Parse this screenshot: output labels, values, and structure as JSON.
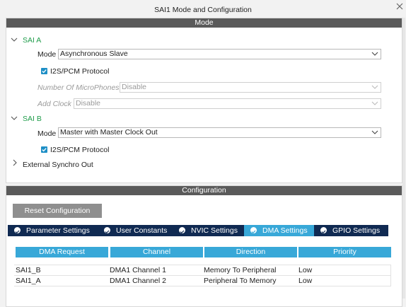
{
  "window": {
    "title": "SAI1 Mode and Configuration"
  },
  "mode_panel": {
    "header": "Mode",
    "sai_a": {
      "label": "SAI A",
      "mode_label": "Mode",
      "mode_value": "Asynchronous Slave",
      "i2s_label": "I2S/PCM Protocol",
      "i2s_checked": true,
      "mics_label": "Number Of MicroPhones",
      "mics_value": "Disable",
      "clock_label": "Add Clock",
      "clock_value": "Disable"
    },
    "sai_b": {
      "label": "SAI B",
      "mode_label": "Mode",
      "mode_value": "Master with Master Clock Out",
      "i2s_label": "I2S/PCM Protocol",
      "i2s_checked": true
    },
    "ext_sync": {
      "label": "External Synchro Out"
    }
  },
  "config_panel": {
    "header": "Configuration",
    "reset_button": "Reset Configuration",
    "tabs": [
      {
        "label": "Parameter Settings",
        "active": false
      },
      {
        "label": "User Constants",
        "active": false
      },
      {
        "label": "NVIC Settings",
        "active": false
      },
      {
        "label": "DMA Settings",
        "active": true
      },
      {
        "label": "GPIO Settings",
        "active": false
      }
    ],
    "dma_table": {
      "columns": [
        "DMA Request",
        "Channel",
        "Direction",
        "Priority"
      ],
      "rows": [
        [
          "SAI1_B",
          "DMA1 Channel 1",
          "Memory To Peripheral",
          "Low"
        ],
        [
          "SAI1_A",
          "DMA1 Channel 2",
          "Peripheral To Memory",
          "Low"
        ]
      ]
    }
  },
  "colors": {
    "accent": "#38a8d8",
    "tab_dark": "#102a52",
    "section_green": "#1f9c4a",
    "header_gray": "#5a5a5a"
  }
}
